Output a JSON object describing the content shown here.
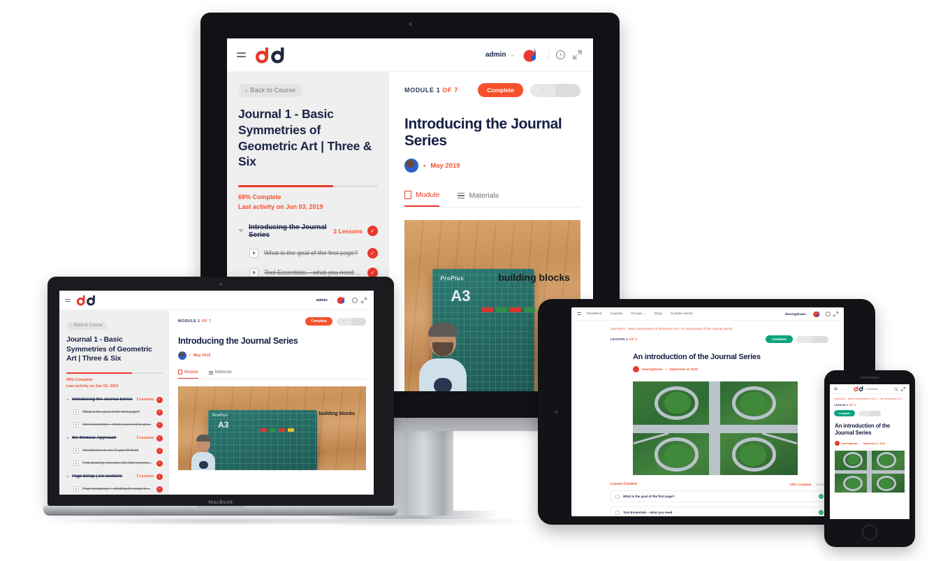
{
  "brand": {
    "logo_text": "dd",
    "community_label": "Community",
    "red": "#e8392c",
    "orange": "#f4512c",
    "navy": "#141f44",
    "green": "#0aa37f"
  },
  "desktop": {
    "header": {
      "menu_icon": "hamburger-icon",
      "logo": "dd",
      "user": "admin",
      "chevron": "⌄",
      "clock_icon": "clock-icon",
      "expand_icon": "expand-icon"
    },
    "sidebar": {
      "back_label": "Back to Course",
      "back_chevron": "‹",
      "course_title": "Journal 1 - Basic Symmetries of Geometric Art | Three & Six",
      "progress_percent": 68,
      "progress_label": "68% Complete",
      "last_activity": "Last activity on Jun 03, 2019",
      "modules": [
        {
          "name": "Introducing the Journal Series",
          "count": "2 Lessons",
          "complete": true,
          "lessons": [
            {
              "name": "What is the goal of the first page?",
              "complete": true
            },
            {
              "name": "Tool Essentials – what you need to get...",
              "complete": true
            }
          ]
        },
        {
          "name": "the Modular Approach",
          "count": "2 Lessons",
          "complete": true,
          "lessons": [
            {
              "name": "Introduction to my Gupta Method",
              "complete": true
            },
            {
              "name": "First drawing exercise, Six fold symme...",
              "complete": true
            }
          ]
        },
        {
          "name": "Page Setup | six sections",
          "count": "2 Lessons",
          "complete": true,
          "lessons": [
            {
              "name": "Page prepping I – dividing the page in...",
              "complete": true
            }
          ]
        }
      ]
    },
    "main": {
      "module_meta_prefix": "MODULE 1",
      "module_meta_suffix": "OF 7",
      "complete_button": "Complete",
      "prev_arrow": "‹",
      "next_arrow": "›",
      "lesson_title": "Introducing the Journal Series",
      "author_separator": "•",
      "date": "May 2019",
      "tabs": [
        {
          "label": "Module",
          "icon": "book-icon",
          "active": true
        },
        {
          "label": "Materials",
          "icon": "list-icon",
          "active": false
        }
      ],
      "video": {
        "mat_brand": "ProPlus",
        "mat_size": "A3",
        "annotation": "building blocks",
        "arrow": "↙"
      }
    }
  },
  "macbook": {
    "label": "MacBook"
  },
  "imac": {
    "apple_logo": "apple-logo"
  },
  "tablet": {
    "nav": [
      "Newsfeed",
      "Courses",
      "Groups ⌄",
      "Shop",
      "Youtube Series"
    ],
    "user": "dearingdraws",
    "chevron": "⌄",
    "clock_icon": "clock-icon",
    "expand_icon": "expand-icon",
    "breadcrumb": "Journal #1 - Basic Symmetries of Geometric Art  ›  An introduction of the Journal Series",
    "lesson_meta_prefix": "LESSON 1",
    "lesson_meta_suffix": "OF 2",
    "complete_button": "Complete",
    "title": "An introduction of the Journal Series",
    "author": "dearingdraws",
    "separator": "•",
    "date": "September 8, 2019",
    "lesson_content_label": "Lesson Content",
    "progress_label": "100% Complete",
    "steps_label": "2/2 Steps",
    "items": [
      {
        "name": "What is the goal of the first page?",
        "complete": true
      },
      {
        "name": "Tool Essentials – what you need",
        "complete": true
      }
    ]
  },
  "phone": {
    "menu_icon": "hamburger-icon",
    "logo": "dd",
    "community_label": "Community",
    "search_icon": "search-icon",
    "expand_icon": "expand-icon",
    "breadcrumb": "Journal #1 - Basic Symmetries of Geo...  ›  An introduction of t...",
    "lesson_meta_prefix": "LESSON 1",
    "lesson_meta_suffix": "OF 2",
    "complete_button": "Complete",
    "title": "An introduction of the Journal Series",
    "author": "dearingdraws",
    "separator": "•",
    "date": "September 8, 2019"
  }
}
